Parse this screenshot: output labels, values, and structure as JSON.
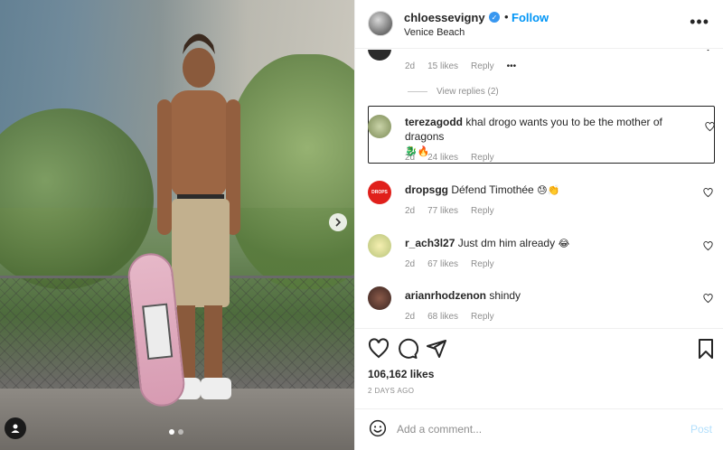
{
  "post": {
    "author": "chloessevigny",
    "follow_label": "Follow",
    "dot": "•",
    "location": "Venice Beach",
    "more_label": "•••"
  },
  "comments": [
    {
      "user": "",
      "text": "",
      "age": "2d",
      "likes": "15 likes",
      "reply": "Reply",
      "options": "•••",
      "view_replies": "View replies (2)"
    },
    {
      "user": "terezagodd",
      "text": "khal drogo wants you to be the mother of dragons",
      "emoji": "🐉🔥",
      "age": "2d",
      "likes": "24 likes",
      "reply": "Reply"
    },
    {
      "user": "dropsgg",
      "text": "Défend Timothée",
      "emoji": "😓👏",
      "age": "2d",
      "likes": "77 likes",
      "reply": "Reply",
      "avatar_text": "DROPS"
    },
    {
      "user": "r_ach3l27",
      "text": "Just dm him already",
      "emoji": "😂",
      "age": "2d",
      "likes": "67 likes",
      "reply": "Reply"
    },
    {
      "user": "arianrhodzenon",
      "text": "shindy",
      "emoji": "",
      "age": "2d",
      "likes": "68 likes",
      "reply": "Reply"
    }
  ],
  "stats": {
    "likes": "106,162 likes",
    "date": "2 DAYS AGO"
  },
  "composer": {
    "placeholder": "Add a comment...",
    "post_label": "Post"
  },
  "colors": {
    "accent": "#0095f6",
    "post_disabled": "#b2dffc",
    "drops_red": "#e0201b"
  },
  "carousel": {
    "slide_count": 2,
    "active_slide": 1
  }
}
